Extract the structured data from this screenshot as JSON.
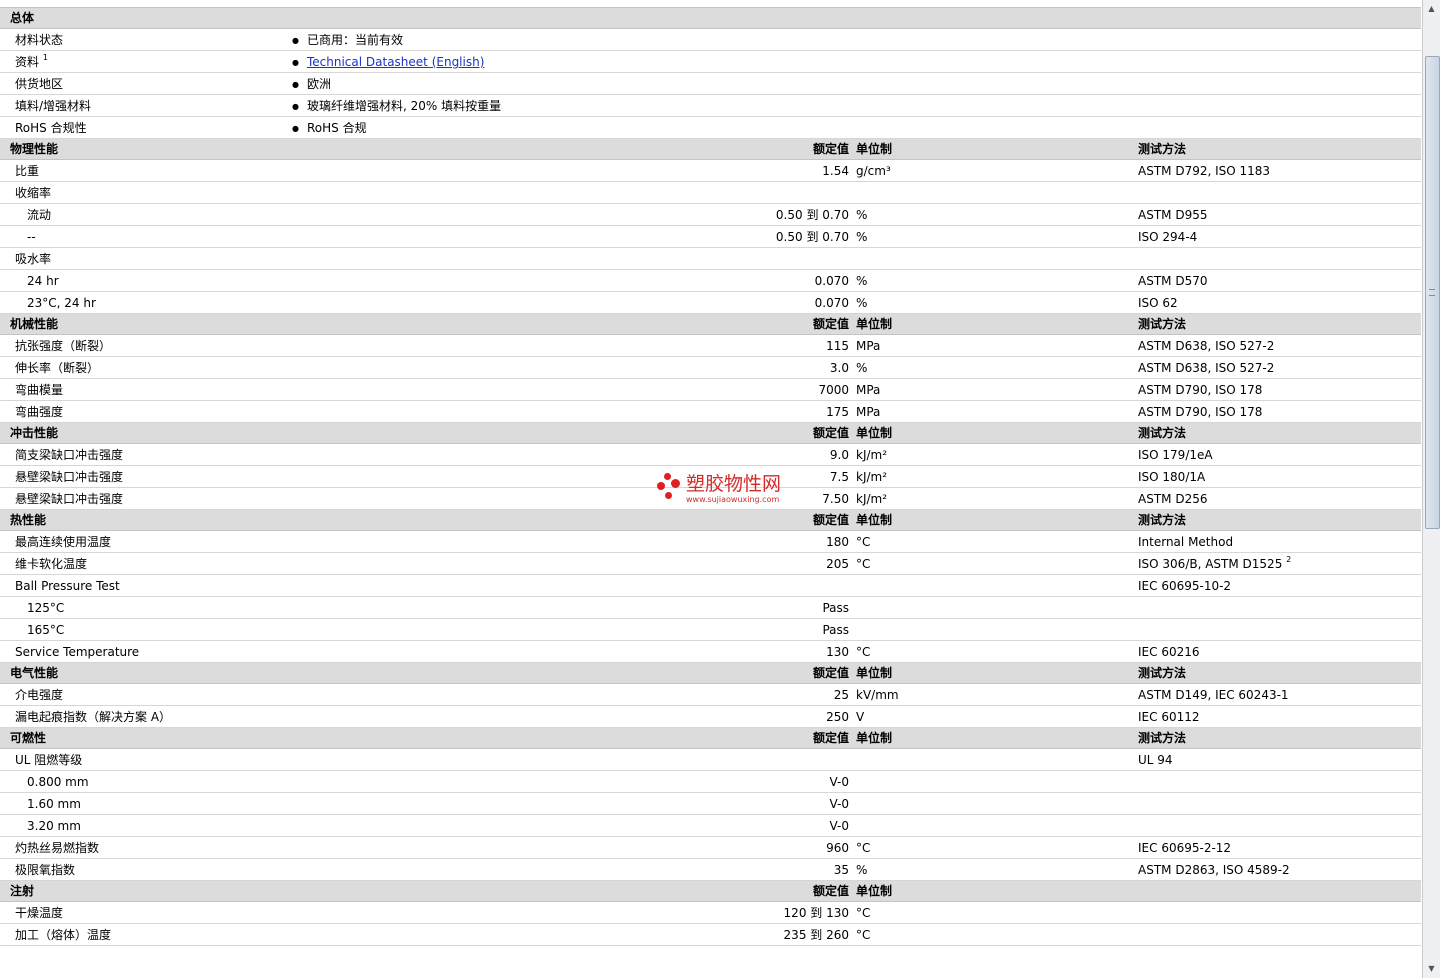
{
  "sections": [
    {
      "title": "总体",
      "kind": "general",
      "rows": [
        {
          "label": "材料状态",
          "value": "已商用：当前有效"
        },
        {
          "label": "资料",
          "sup": "1",
          "value": "Technical Datasheet (English)",
          "link": true
        },
        {
          "label": "供货地区",
          "value": "欧洲"
        },
        {
          "label": "填料/增强材料",
          "value": "玻璃纤维增强材料, 20% 填料按重量"
        },
        {
          "label": "RoHS 合规性",
          "value": "RoHS 合规"
        }
      ]
    },
    {
      "title": "物理性能",
      "kind": "table",
      "rows": [
        {
          "label": "比重",
          "value": "1.54",
          "unit": "g/cm³",
          "test": "ASTM D792, ISO 1183"
        },
        {
          "label": "收缩率"
        },
        {
          "label": "流动",
          "sub": true,
          "value": "0.50 到  0.70",
          "unit": "%",
          "test": "ASTM D955"
        },
        {
          "label": "--",
          "sub": true,
          "value": "0.50 到  0.70",
          "unit": "%",
          "test": "ISO 294-4"
        },
        {
          "label": "吸水率"
        },
        {
          "label": "24 hr",
          "sub": true,
          "value": "0.070",
          "unit": "%",
          "test": "ASTM D570"
        },
        {
          "label": "23°C, 24 hr",
          "sub": true,
          "value": "0.070",
          "unit": "%",
          "test": "ISO 62"
        }
      ]
    },
    {
      "title": "机械性能",
      "kind": "table",
      "rows": [
        {
          "label": "抗张强度（断裂）",
          "value": "115",
          "unit": "MPa",
          "test": "ASTM D638, ISO 527-2"
        },
        {
          "label": "伸长率（断裂）",
          "value": "3.0",
          "unit": "%",
          "test": "ASTM D638, ISO 527-2"
        },
        {
          "label": "弯曲模量",
          "value": "7000",
          "unit": "MPa",
          "test": "ASTM D790, ISO 178"
        },
        {
          "label": "弯曲强度",
          "value": "175",
          "unit": "MPa",
          "test": "ASTM D790, ISO 178"
        }
      ]
    },
    {
      "title": "冲击性能",
      "kind": "table",
      "rows": [
        {
          "label": "简支梁缺口冲击强度",
          "value": "9.0",
          "unit": "kJ/m²",
          "test": "ISO 179/1eA"
        },
        {
          "label": "悬壁梁缺口冲击强度",
          "value": "7.5",
          "unit": "kJ/m²",
          "test": "ISO 180/1A"
        },
        {
          "label": "悬壁梁缺口冲击强度",
          "value": "7.50",
          "unit": "kJ/m²",
          "test": "ASTM D256"
        }
      ]
    },
    {
      "title": "热性能",
      "kind": "table",
      "rows": [
        {
          "label": "最高连续使用温度",
          "value": "180",
          "unit": "°C",
          "test": "Internal Method"
        },
        {
          "label": "维卡软化温度",
          "value": "205",
          "unit": "°C",
          "test": "ISO 306/B, ASTM D1525",
          "test_sup": "2"
        },
        {
          "label": "Ball Pressure Test",
          "test": "IEC 60695-10-2"
        },
        {
          "label": "125°C",
          "sub": true,
          "value": "Pass"
        },
        {
          "label": "165°C",
          "sub": true,
          "value": "Pass"
        },
        {
          "label": "Service Temperature",
          "value": "130",
          "unit": "°C",
          "test": "IEC 60216"
        }
      ]
    },
    {
      "title": "电气性能",
      "kind": "table",
      "rows": [
        {
          "label": "介电强度",
          "value": "25",
          "unit": "kV/mm",
          "test": "ASTM D149, IEC 60243-1"
        },
        {
          "label": "漏电起痕指数（解决方案 A）",
          "value": "250",
          "unit": "V",
          "test": "IEC 60112"
        }
      ]
    },
    {
      "title": "可燃性",
      "kind": "table",
      "rows": [
        {
          "label": "UL 阻燃等级",
          "test": "UL 94"
        },
        {
          "label": "0.800 mm",
          "sub": true,
          "value": "V-0"
        },
        {
          "label": "1.60 mm",
          "sub": true,
          "value": "V-0"
        },
        {
          "label": "3.20 mm",
          "sub": true,
          "value": "V-0"
        },
        {
          "label": "灼热丝易燃指数",
          "value": "960",
          "unit": "°C",
          "test": "IEC 60695-2-12"
        },
        {
          "label": "极限氧指数",
          "value": "35",
          "unit": "%",
          "test": "ASTM D2863, ISO 4589-2"
        }
      ]
    },
    {
      "title": "注射",
      "kind": "table",
      "no_test_header": true,
      "rows": [
        {
          "label": "干燥温度",
          "value": "120 到  130",
          "unit": "°C"
        },
        {
          "label": "加工（熔体）温度",
          "value": "235 到  260",
          "unit": "°C"
        }
      ]
    }
  ],
  "headers": {
    "value": "额定值",
    "unit": "单位制",
    "test": "测试方法"
  },
  "watermark": {
    "name": "塑胶物性网",
    "url": "www.sujiaowuxing.com"
  },
  "scrollbar": {
    "position_fraction": 0.04,
    "visible_fraction": 0.5
  }
}
